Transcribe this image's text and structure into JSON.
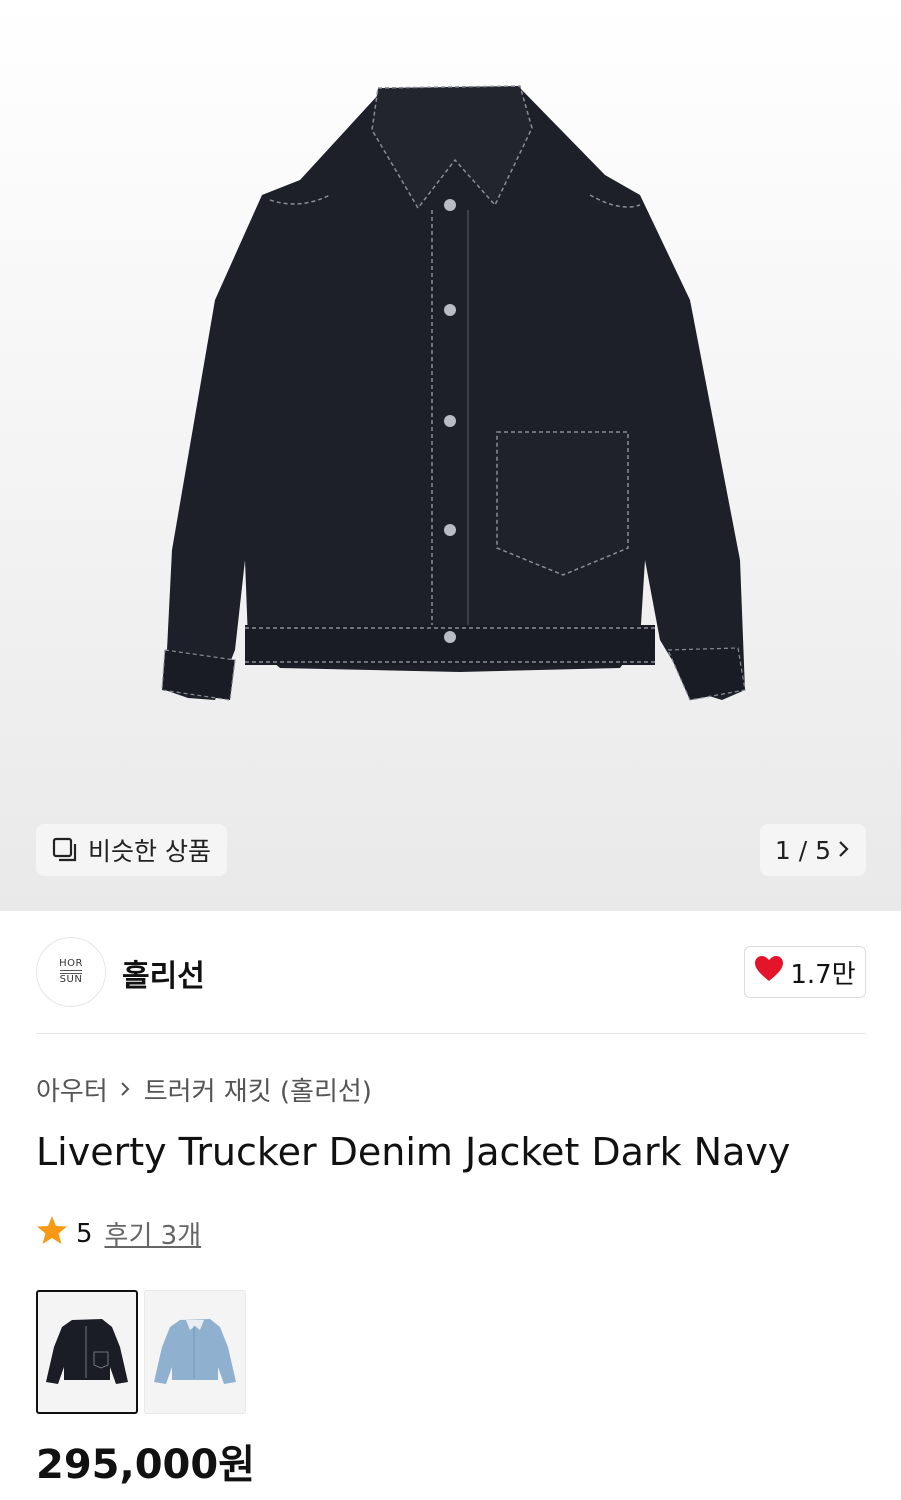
{
  "gallery": {
    "similar_label": "비슷한 상품",
    "pager": "1 / 5"
  },
  "brand": {
    "logo_top": "HOR",
    "logo_bottom": "SUN",
    "name": "홀리선",
    "likes": "1.7만"
  },
  "breadcrumb": {
    "category": "아우터",
    "subcategory": "트러커 재킷 (홀리선)"
  },
  "product": {
    "title": "Liverty Trucker Denim Jacket Dark Navy",
    "rating": "5",
    "review_label": "후기 3개",
    "price": "295,000원"
  },
  "variants": [
    {
      "name": "dark-navy",
      "color": "#1a1c26"
    },
    {
      "name": "light-blue",
      "color": "#8fb1cf"
    }
  ],
  "colors": {
    "heart": "#e5142b",
    "star": "#f59a12",
    "denim_dark": "#1d1f29"
  }
}
